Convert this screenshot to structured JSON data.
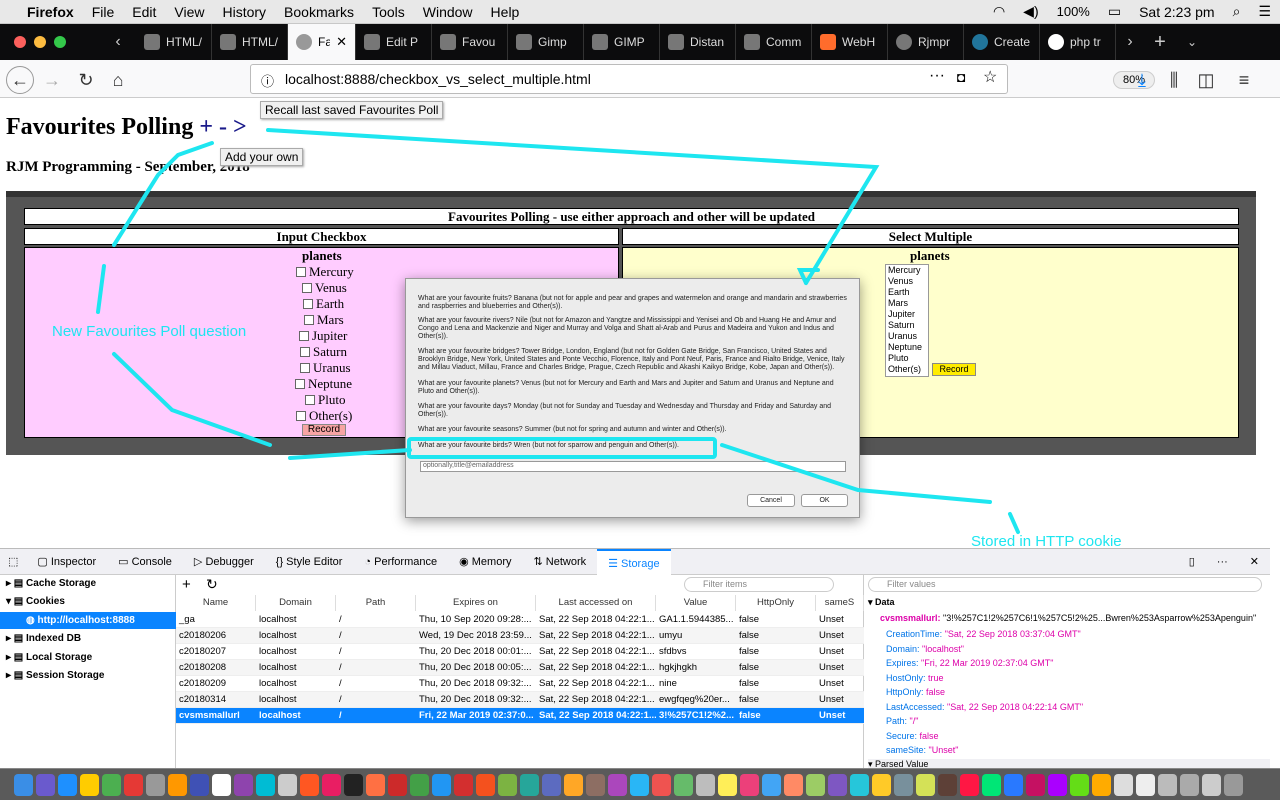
{
  "menubar": {
    "app": "Firefox",
    "items": [
      "File",
      "Edit",
      "View",
      "History",
      "Bookmarks",
      "Tools",
      "Window",
      "Help"
    ],
    "battery": "100%",
    "clock": "Sat 2:23 pm"
  },
  "tabs": [
    {
      "label": "HTML/"
    },
    {
      "label": "HTML/"
    },
    {
      "label": "Fav"
    },
    {
      "label": "Edit P"
    },
    {
      "label": "Favou"
    },
    {
      "label": "Gimp"
    },
    {
      "label": "GIMP"
    },
    {
      "label": "Distan"
    },
    {
      "label": "Comm"
    },
    {
      "label": "WebH"
    },
    {
      "label": "Rjmpr"
    },
    {
      "label": "Create"
    },
    {
      "label": "php tr"
    }
  ],
  "tab_close": "✕",
  "url": "localhost:8888/checkbox_vs_select_multiple.html",
  "zoom": "80%",
  "page": {
    "title": "Favourites Polling",
    "title_controls": "+ - >",
    "subtitle": "RJM Programming - September, 2018",
    "tooltip_recall": "Recall last saved Favourites Poll",
    "tooltip_add": "Add your own",
    "table_title": "Favourites Polling - use either approach and other will be updated",
    "col_left": "Input Checkbox",
    "col_right": "Select Multiple",
    "topic_left": "planets",
    "topic_right": "planets",
    "options": [
      "Mercury",
      "Venus",
      "Earth",
      "Mars",
      "Jupiter",
      "Saturn",
      "Uranus",
      "Neptune",
      "Pluto",
      "Other(s)"
    ],
    "record_label": "Record"
  },
  "dialog": {
    "questions": [
      "What are your favourite fruits?  Banana (but not for apple and pear and grapes and watermelon and orange and mandarin and strawberries and raspberries and blueberries and Other(s)).",
      "What are your favourite rivers?  Nile (but not for Amazon and Yangtze and Mississippi and Yenisei and Ob and Huang He and Amur and Congo and Lena and Mackenzie and Niger and Murray and Volga and Shatt al-Arab and Purus and Madeira and Yukon and Indus and Other(s)).",
      "What are your favourite bridges?  Tower Bridge, London, England (but not for Golden Gate Bridge, San Francisco, United States and Brooklyn Bridge, New York, United States and Ponte Vecchio, Florence, Italy and Pont Neuf, Paris, France and Rialto Bridge, Venice, Italy and Millau Viaduct, Millau, France and Charles Bridge, Prague, Czech Republic and Akashi Kaikyo Bridge, Kobe, Japan and Other(s)).",
      "What are your favourite planets?  Venus (but not for Mercury and Earth and Mars and Jupiter and Saturn and Uranus and Neptune and Pluto and Other(s)).",
      "What are your favourite days?  Monday (but not for Sunday and Tuesday and Wednesday and Thursday and Friday and Saturday and Other(s)).",
      "What are your favourite seasons?  Summer (but not for spring and autumn and winter and Other(s)).",
      "What are your favourite birds?  Wren (but not for sparrow and penguin and Other(s))."
    ],
    "input_placeholder": "optionally,title@emailaddress",
    "cancel": "Cancel",
    "ok": "OK"
  },
  "annotations": {
    "new_question": "New Favourites Poll question",
    "stored": "Stored in HTTP cookie"
  },
  "devtools": {
    "tabs": [
      "Inspector",
      "Console",
      "Debugger",
      "Style Editor",
      "Performance",
      "Memory",
      "Network",
      "Storage"
    ],
    "selected_tab": "Storage",
    "tree": [
      "Cache Storage",
      "Cookies",
      "http://localhost:8888",
      "Indexed DB",
      "Local Storage",
      "Session Storage"
    ],
    "filter_items": "Filter items",
    "filter_values": "Filter values",
    "columns": [
      "Name",
      "Domain",
      "Path",
      "Expires on",
      "Last accessed on",
      "Value",
      "HttpOnly",
      "sameS"
    ],
    "rows": [
      [
        "_ga",
        "localhost",
        "/",
        "Thu, 10 Sep 2020 09:28:...",
        "Sat, 22 Sep 2018 04:22:1...",
        "GA1.1.5944385...",
        "false",
        "Unset"
      ],
      [
        "c20180206",
        "localhost",
        "/",
        "Wed, 19 Dec 2018 23:59...",
        "Sat, 22 Sep 2018 04:22:1...",
        "umyu",
        "false",
        "Unset"
      ],
      [
        "c20180207",
        "localhost",
        "/",
        "Thu, 20 Dec 2018 00:01:...",
        "Sat, 22 Sep 2018 04:22:1...",
        "sfdbvs",
        "false",
        "Unset"
      ],
      [
        "c20180208",
        "localhost",
        "/",
        "Thu, 20 Dec 2018 00:05:...",
        "Sat, 22 Sep 2018 04:22:1...",
        "hgkjhgkh",
        "false",
        "Unset"
      ],
      [
        "c20180209",
        "localhost",
        "/",
        "Thu, 20 Dec 2018 09:32:...",
        "Sat, 22 Sep 2018 04:22:1...",
        "nine",
        "false",
        "Unset"
      ],
      [
        "c20180314",
        "localhost",
        "/",
        "Thu, 20 Dec 2018 09:32:...",
        "Sat, 22 Sep 2018 04:22:1...",
        "ewgfqeg%20er...",
        "false",
        "Unset"
      ],
      [
        "cvsmsmallurl",
        "localhost",
        "/",
        "Fri, 22 Mar 2019 02:37:0...",
        "Sat, 22 Sep 2018 04:22:1...",
        "3!%257C1!2%2...",
        "false",
        "Unset"
      ]
    ],
    "sidebar": {
      "data_label": "Data",
      "cookie_key": "cvsmsmallurl:",
      "cookie_value": "\"3!%257C1!2%257C6!1%257C5!2%25...Bwren%253Asparrow%253Apenguin\"",
      "fields": [
        {
          "k": "CreationTime:",
          "v": "\"Sat, 22 Sep 2018 03:37:04 GMT\""
        },
        {
          "k": "Domain:",
          "v": "\"localhost\""
        },
        {
          "k": "Expires:",
          "v": "\"Fri, 22 Mar 2019 02:37:04 GMT\""
        },
        {
          "k": "HostOnly:",
          "v": "true"
        },
        {
          "k": "HttpOnly:",
          "v": "false"
        },
        {
          "k": "LastAccessed:",
          "v": "\"Sat, 22 Sep 2018 04:22:14 GMT\""
        },
        {
          "k": "Path:",
          "v": "\"/\""
        },
        {
          "k": "Secure:",
          "v": "false"
        },
        {
          "k": "sameSite:",
          "v": "\"Unset\""
        }
      ],
      "parsed_label": "Parsed Value"
    }
  },
  "colors": {
    "annotation": "#1ee6f0",
    "selection": "#0a84ff",
    "checkbox_panel": "#ffccff",
    "select_panel": "#ffffcc",
    "record_left": "#f7a4a4",
    "record_right": "#ffec00"
  }
}
